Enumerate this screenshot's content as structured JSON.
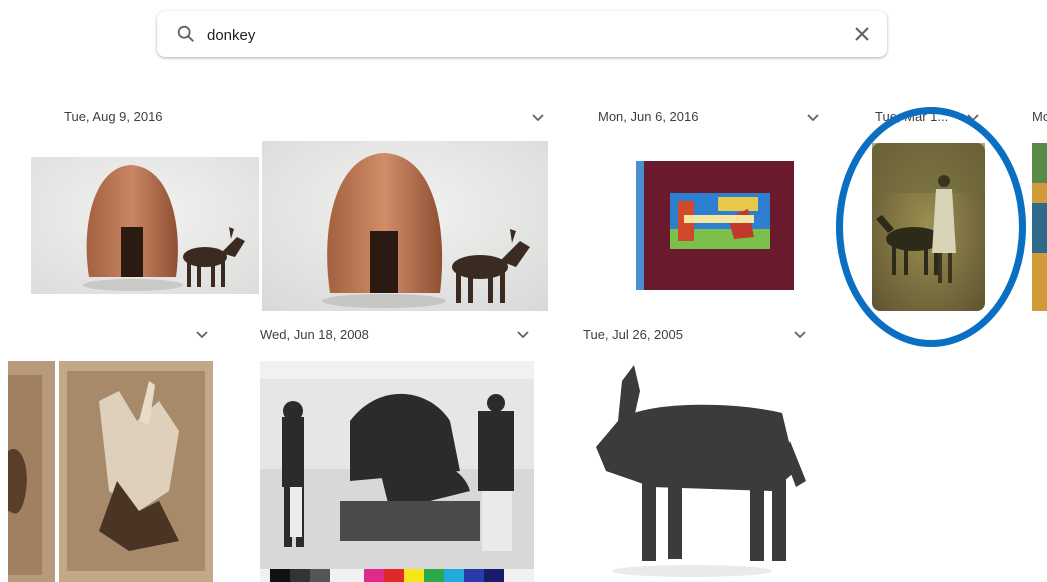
{
  "search": {
    "query": "donkey"
  },
  "groups": [
    {
      "date": "Tue, Aug 9, 2016"
    },
    {
      "date": "Mon, Jun 6, 2016"
    },
    {
      "date": "Tue, Mar 1..."
    },
    {
      "date": "Mo"
    },
    {
      "date": "Wed, Jun 18, 2008"
    },
    {
      "date": "Tue, Jul 26, 2005"
    }
  ],
  "photos": [
    {
      "subject": "clay hut and donkey figurine"
    },
    {
      "subject": "clay hut and donkey figurine"
    },
    {
      "subject": "book cover with donkey illustration"
    },
    {
      "subject": "tintype of woman beside donkey"
    },
    {
      "subject": "etching of donkeys"
    },
    {
      "subject": "etching of donkey on man"
    },
    {
      "subject": "photo of camels and men"
    },
    {
      "subject": "bronze bull figurine"
    }
  ],
  "colors": {
    "highlight": "#0a6fc2",
    "icon": "#5f6368"
  }
}
